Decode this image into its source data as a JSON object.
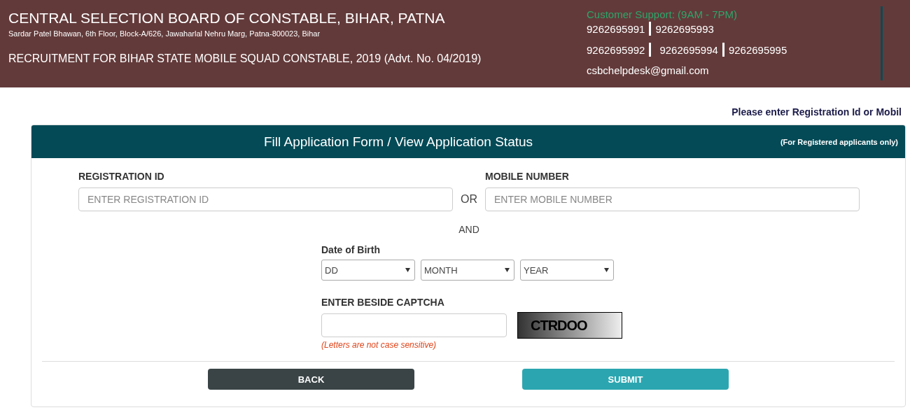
{
  "header": {
    "title": "CENTRAL SELECTION BOARD OF CONSTABLE, BIHAR, PATNA",
    "address": "Sardar Patel Bhawan, 6th Floor, Block-A/626, Jawaharlal Nehru Marg, Patna-800023, Bihar",
    "recruitment": "RECRUITMENT FOR BIHAR STATE MOBILE SQUAD CONSTABLE, 2019 (Advt. No. 04/2019)"
  },
  "support": {
    "heading": "Customer Support: (9AM - 7PM)",
    "phone_rows": [
      [
        "9262695991",
        "9262695993"
      ],
      [
        "9262695992",
        "9262695994",
        "9262695995"
      ]
    ],
    "email": "csbchelpdesk@gmail.com"
  },
  "notice": "Please enter Registration Id or Mobil",
  "form": {
    "title": "Fill Application Form / View Application Status",
    "note": "(For Registered applicants only)",
    "registration": {
      "label": "REGISTRATION ID",
      "placeholder": "ENTER REGISTRATION ID"
    },
    "or": "OR",
    "mobile": {
      "label": "MOBILE NUMBER",
      "placeholder": "ENTER MOBILE NUMBER"
    },
    "and": "AND",
    "dob": {
      "label": "Date of Birth",
      "selects": [
        "DD",
        "MONTH",
        "YEAR"
      ]
    },
    "captcha": {
      "label": "ENTER BESIDE CAPTCHA",
      "code": "CTRDOO",
      "hint": "(Letters are not case sensitive)"
    },
    "buttons": [
      {
        "label": "BACK",
        "kind": "secondary"
      },
      {
        "label": "SUBMIT",
        "kind": "primary"
      }
    ]
  }
}
